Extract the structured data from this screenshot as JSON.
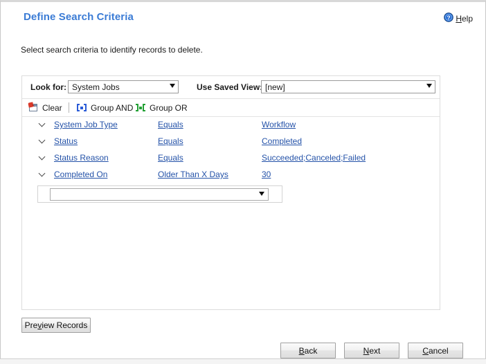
{
  "header": {
    "title": "Define Search Criteria",
    "help": {
      "label_pre": "H",
      "label_post": "elp",
      "icon": "help-circle-icon"
    }
  },
  "instruction": "Select search criteria to identify records to delete.",
  "criteria_panel": {
    "look_for": {
      "label": "Look for:",
      "value": "System Jobs"
    },
    "use_saved_view": {
      "label": "Use Saved View:",
      "value": "[new]"
    },
    "toolbar": {
      "clear": {
        "label": "Clear",
        "icon": "clear-note-pin-icon"
      },
      "group_and": {
        "label": "Group AND",
        "icon": "group-and-bracket-icon",
        "color": "#2a5bd7"
      },
      "group_or": {
        "label": "Group OR",
        "icon": "group-or-bracket-icon",
        "color": "#21a033"
      }
    },
    "rows": [
      {
        "field": "System Job Type",
        "operator": "Equals",
        "value": "Workflow"
      },
      {
        "field": "Status",
        "operator": "Equals",
        "value": "Completed"
      },
      {
        "field": "Status Reason",
        "operator": "Equals",
        "value": "Succeeded;Canceled;Failed"
      },
      {
        "field": "Completed On",
        "operator": "Older Than X Days",
        "value": "30"
      }
    ],
    "new_criteria": {
      "value": "",
      "placeholder": ""
    }
  },
  "buttons": {
    "preview_records": {
      "pre": "Pre",
      "key": "v",
      "post": "iew Records"
    },
    "back": {
      "pre": "",
      "key": "B",
      "post": "ack"
    },
    "next": {
      "pre": "",
      "key": "N",
      "post": "ext"
    },
    "cancel": {
      "pre": "",
      "key": "C",
      "post": "ancel"
    }
  },
  "colors": {
    "title_blue": "#3a7bd5",
    "link_blue": "#2452a8",
    "panel_border": "#dcdcdc"
  }
}
